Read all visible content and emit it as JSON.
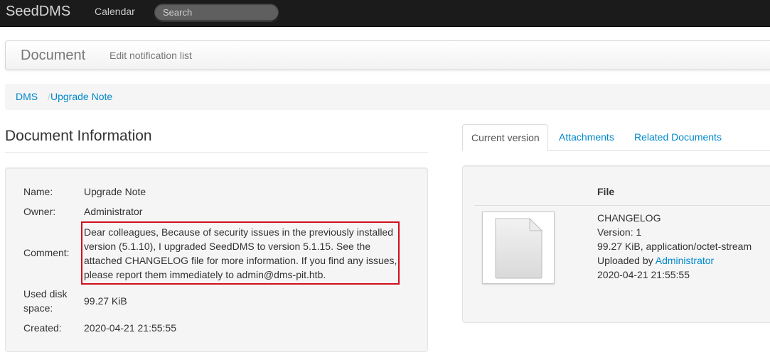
{
  "navbar": {
    "brand": "SeedDMS",
    "links": [
      "Calendar"
    ],
    "search_placeholder": "Search"
  },
  "subnav": {
    "title": "Document",
    "link": "Edit notification list"
  },
  "breadcrumb": {
    "items": [
      "DMS",
      "Upgrade Note"
    ],
    "separator": "/"
  },
  "document_info": {
    "heading": "Document Information",
    "fields": {
      "name_label": "Name:",
      "name_value": "Upgrade Note",
      "owner_label": "Owner:",
      "owner_value": "Administrator",
      "comment_label": "Comment:",
      "comment_value": "Dear colleagues, Because of security issues in the previously installed version (5.1.10), I upgraded SeedDMS to version 5.1.15. See the attached CHANGELOG file for more information. If you find any issues, please report them immediately to admin@dms-pit.htb.",
      "disk_label_line1": "Used disk",
      "disk_label_line2": "space:",
      "disk_value": "99.27 KiB",
      "created_label": "Created:",
      "created_value": "2020-04-21 21:55:55"
    }
  },
  "tabs": {
    "items": [
      "Current version",
      "Attachments",
      "Related Documents"
    ],
    "active": "Current version"
  },
  "current_version": {
    "column_header": "File",
    "file": {
      "name": "CHANGELOG",
      "version": "Version: 1",
      "size_type": "99.27 KiB, application/octet-stream",
      "uploaded_by_prefix": "Uploaded by",
      "uploaded_by": "Administrator",
      "date": "2020-04-21 21:55:55",
      "thumbnail_icon": "document-file-icon"
    }
  },
  "colors": {
    "navbar_bg": "#1b1b1b",
    "link": "#0088cc",
    "highlight_border": "#d10f1d"
  }
}
